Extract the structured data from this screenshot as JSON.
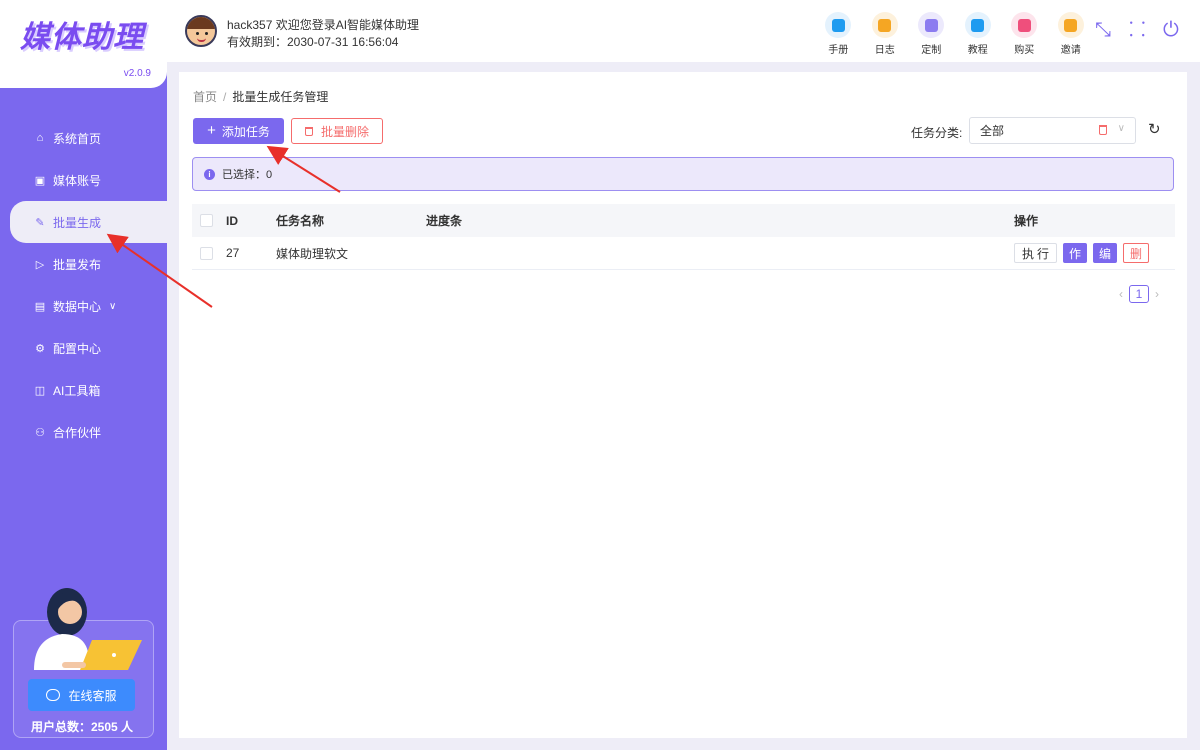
{
  "app": {
    "logo_text": "媒体助理",
    "version": "v2.0.9"
  },
  "sidebar": {
    "items": [
      {
        "label": "系统首页",
        "icon": "home-icon"
      },
      {
        "label": "媒体账号",
        "icon": "id-card-icon"
      },
      {
        "label": "批量生成",
        "icon": "pen-icon",
        "active": true
      },
      {
        "label": "批量发布",
        "icon": "send-icon"
      },
      {
        "label": "数据中心",
        "icon": "database-icon"
      },
      {
        "label": "配置中心",
        "icon": "gear-icon"
      },
      {
        "label": "AI工具箱",
        "icon": "toolbox-icon"
      },
      {
        "label": "合作伙伴",
        "icon": "partners-icon"
      }
    ],
    "service_button": "在线客服",
    "user_total": "用户总数：2505 人"
  },
  "header": {
    "user_line1": "hack357 欢迎您登录AI智能媒体助理",
    "user_line2": "有效期到：2030-07-31 16:56:04",
    "tools": [
      {
        "label": "手册",
        "icon": "manual-icon",
        "color": "#1e9bf0"
      },
      {
        "label": "日志",
        "icon": "log-icon",
        "color": "#f5a623"
      },
      {
        "label": "定制",
        "icon": "custom-icon",
        "color": "#8c7cf0"
      },
      {
        "label": "教程",
        "icon": "tutorial-icon",
        "color": "#1e9bf0"
      },
      {
        "label": "购买",
        "icon": "buy-icon",
        "color": "#ef4f7c"
      },
      {
        "label": "邀请",
        "icon": "invite-icon",
        "color": "#f5a623"
      }
    ]
  },
  "main": {
    "breadcrumb": {
      "home": "首页",
      "sep": "/",
      "current": "批量生成任务管理"
    },
    "add_button": "添加任务",
    "batch_delete_button": "批量删除",
    "category_label": "任务分类:",
    "category_value": "全部",
    "selection_text": "已选择：0",
    "table": {
      "headers": {
        "id": "ID",
        "name": "任务名称",
        "progress": "进度条",
        "ops": "操作"
      },
      "rows": [
        {
          "id": "27",
          "name": "媒体助理软文",
          "progress": ""
        }
      ],
      "op_labels": {
        "exec": "执行",
        "work": "作",
        "edit": "编",
        "del": "删"
      }
    },
    "pagination": {
      "current": "1"
    }
  },
  "colors": {
    "primary": "#7b68ee",
    "danger": "#f56c6c",
    "bg": "#eeedf7"
  }
}
